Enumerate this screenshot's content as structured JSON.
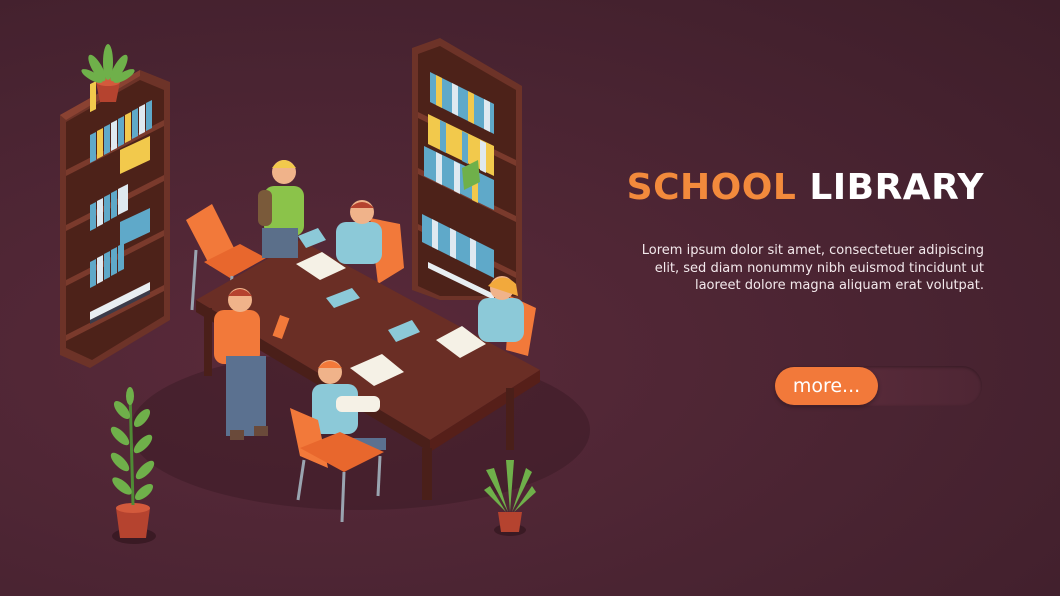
{
  "banner": {
    "title_part1": "SCHOOL",
    "title_part2": "LIBRARY",
    "description_lines": [
      "Lorem ipsum dolor sit amet, consectetuer adipiscing",
      "elit, sed diam nonummy nibh euismod tincidunt ut",
      "laoreet dolore magna aliquam erat volutpat."
    ],
    "more_label": "more..."
  },
  "colors": {
    "background": "#4a2432",
    "accent": "#f2793a",
    "title_accent": "#f28a3c",
    "title_main": "#ffffff",
    "text": "#f3e9ec"
  },
  "illustration": {
    "subject": "library-reading-table-scene",
    "icons": [
      "bookshelf-icon",
      "reading-table-icon",
      "student-icon",
      "chair-icon",
      "potted-plant-icon",
      "book-icon"
    ]
  }
}
